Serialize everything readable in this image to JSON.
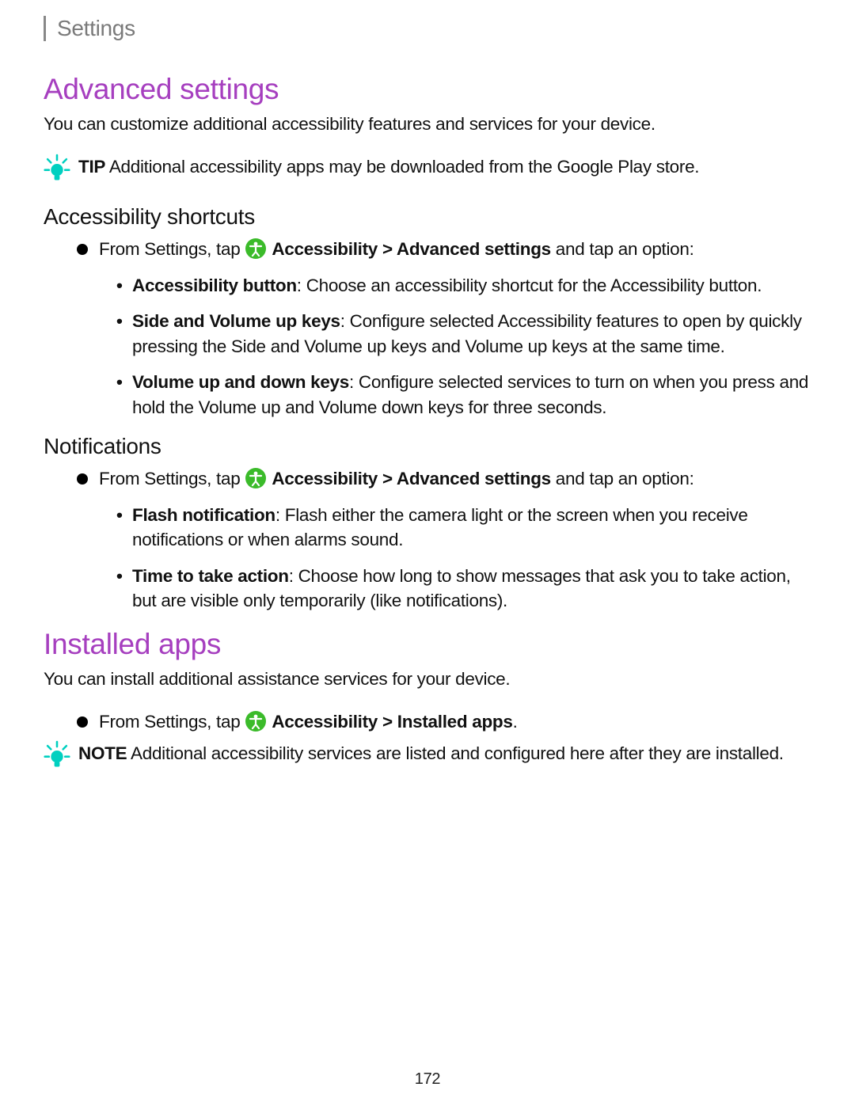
{
  "header": {
    "breadcrumb": "Settings"
  },
  "section1": {
    "title": "Advanced settings",
    "intro": "You can customize additional accessibility features and services for your device.",
    "tip": {
      "label": "TIP",
      "text": "Additional accessibility apps may be downloaded from the Google Play store."
    },
    "sub1": {
      "title": "Accessibility shortcuts",
      "step_prefix": "From Settings, tap ",
      "step_path": "Accessibility > Advanced settings",
      "step_suffix": " and tap an option:",
      "items": [
        {
          "bold": "Accessibility button",
          "rest": ": Choose an accessibility shortcut for the Accessibility button."
        },
        {
          "bold": "Side and Volume up keys",
          "rest": ": Configure selected Accessibility features to open by quickly pressing the Side and Volume up keys and Volume up keys at the same time."
        },
        {
          "bold": "Volume up and down keys",
          "rest": ": Configure selected services to turn on when you press and hold the Volume up and Volume down keys for three seconds."
        }
      ]
    },
    "sub2": {
      "title": "Notifications",
      "step_prefix": "From Settings, tap ",
      "step_path": "Accessibility > Advanced settings",
      "step_suffix": " and tap an option:",
      "items": [
        {
          "bold": "Flash notification",
          "rest": ": Flash either the camera light or the screen when you receive notifications or when alarms sound."
        },
        {
          "bold": "Time to take action",
          "rest": ": Choose how long to show messages that ask you to take action, but are visible only temporarily (like notifications)."
        }
      ]
    }
  },
  "section2": {
    "title": "Installed apps",
    "intro": "You can install additional assistance services for your device.",
    "step_prefix": "From Settings, tap ",
    "step_path": "Accessibility > Installed apps",
    "step_suffix": ".",
    "note": {
      "label": "NOTE",
      "text": "Additional accessibility services are listed and configured here after they are installed."
    }
  },
  "page_number": "172"
}
